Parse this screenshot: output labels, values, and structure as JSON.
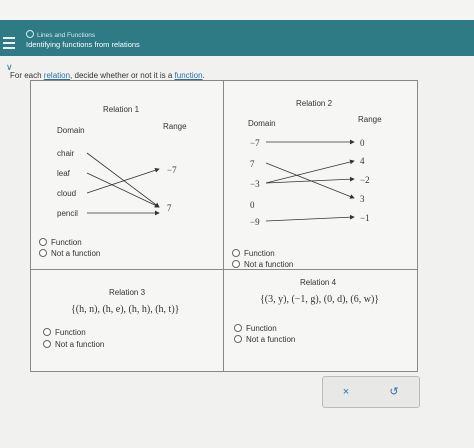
{
  "header": {
    "breadcrumb": "Lines and Functions",
    "subtitle": "Identifying functions from relations"
  },
  "instruction": {
    "prefix": "For each ",
    "link1": "relation",
    "middle": ", decide whether or not it is a ",
    "link2": "function",
    "suffix": "."
  },
  "relation1": {
    "title": "Relation 1",
    "domain_label": "Domain",
    "range_label": "Range",
    "domain": [
      "chair",
      "leaf",
      "cloud",
      "pencil"
    ],
    "range": [
      "−7",
      "7"
    ],
    "options": [
      "Function",
      "Not a function"
    ]
  },
  "relation2": {
    "title": "Relation 2",
    "domain_label": "Domain",
    "range_label": "Range",
    "domain": [
      "−7",
      "7",
      "−3",
      "0",
      "−9"
    ],
    "range": [
      "0",
      "4",
      "−2",
      "3",
      "−1"
    ],
    "options": [
      "Function",
      "Not a function"
    ]
  },
  "relation3": {
    "title": "Relation 3",
    "set": "{(h, n), (h, e), (h, h), (h, t)}",
    "options": [
      "Function",
      "Not a function"
    ]
  },
  "relation4": {
    "title": "Relation 4",
    "set": "{(3, y), (−1, g), (0, d), (6, w)}",
    "options": [
      "Function",
      "Not a function"
    ]
  },
  "buttons": {
    "clear": "×",
    "undo": "↺"
  }
}
